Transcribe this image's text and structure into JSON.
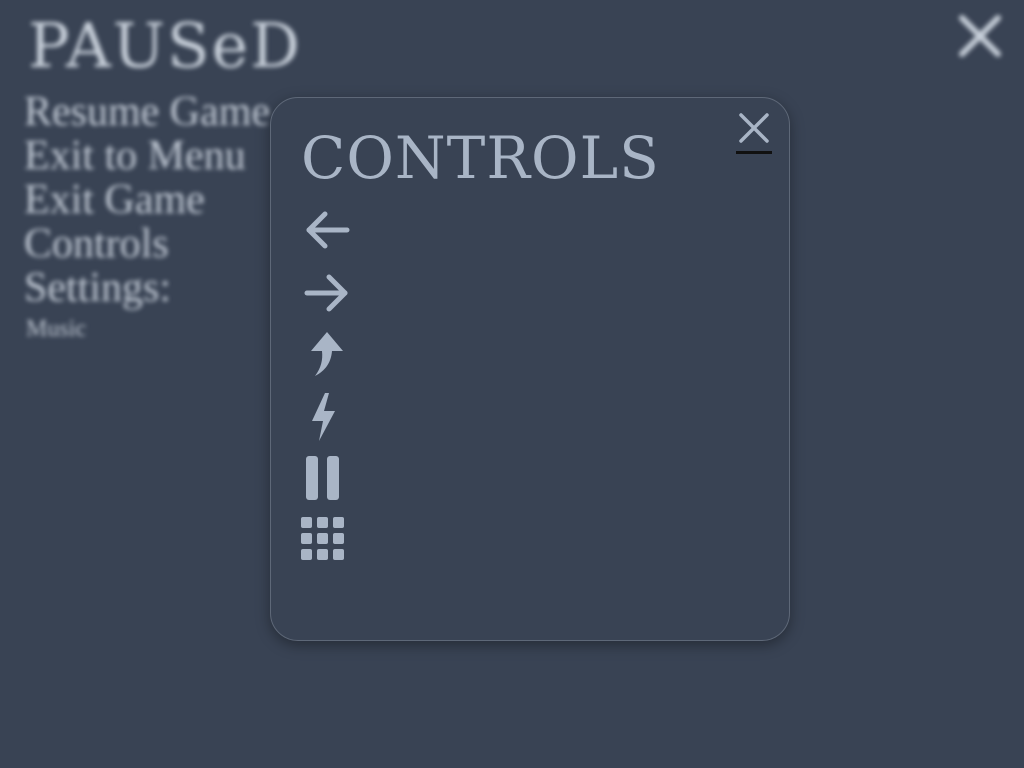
{
  "colors": {
    "background": "#394354",
    "icon": "#a9b5c6",
    "text_blurred": "#c3cbd6",
    "close_underline": "#111111"
  },
  "pause_menu": {
    "title": "PAUSeD",
    "items": [
      {
        "label": "Resume Game"
      },
      {
        "label": "Exit to Menu"
      },
      {
        "label": "Exit Game"
      },
      {
        "label": "Controls"
      },
      {
        "label": "Settings:"
      }
    ],
    "sub_item": "Music",
    "close_icon": "close-icon"
  },
  "controls_dialog": {
    "title": "CONTROLS",
    "close_icon": "close-icon",
    "controls": [
      {
        "icon": "arrow-left-icon",
        "label": ""
      },
      {
        "icon": "arrow-right-icon",
        "label": ""
      },
      {
        "icon": "jump-arrow-icon",
        "label": ""
      },
      {
        "icon": "lightning-icon",
        "label": ""
      },
      {
        "icon": "pause-icon",
        "label": ""
      },
      {
        "icon": "grid-menu-icon",
        "label": ""
      }
    ]
  }
}
